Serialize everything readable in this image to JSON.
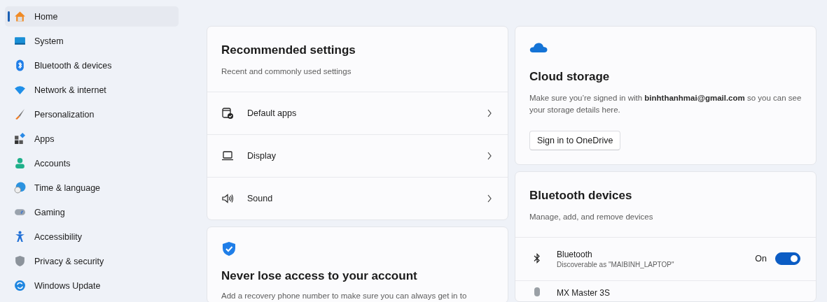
{
  "sidebar": {
    "items": [
      {
        "label": "Home",
        "selected": true
      },
      {
        "label": "System",
        "selected": false
      },
      {
        "label": "Bluetooth & devices",
        "selected": false
      },
      {
        "label": "Network & internet",
        "selected": false
      },
      {
        "label": "Personalization",
        "selected": false
      },
      {
        "label": "Apps",
        "selected": false
      },
      {
        "label": "Accounts",
        "selected": false
      },
      {
        "label": "Time & language",
        "selected": false
      },
      {
        "label": "Gaming",
        "selected": false
      },
      {
        "label": "Accessibility",
        "selected": false
      },
      {
        "label": "Privacy & security",
        "selected": false
      },
      {
        "label": "Windows Update",
        "selected": false
      }
    ]
  },
  "recommended": {
    "title": "Recommended settings",
    "subtitle": "Recent and commonly used settings",
    "items": [
      {
        "label": "Default apps"
      },
      {
        "label": "Display"
      },
      {
        "label": "Sound"
      }
    ]
  },
  "account_card": {
    "title": "Never lose access to your account",
    "text": "Add a recovery phone number to make sure you can always get in to"
  },
  "cloud_storage": {
    "title": "Cloud storage",
    "text": "Make sure you’re signed in with **binhthanhmai@gmail.com** so you can see your storage details here.",
    "button": "Sign in to OneDrive"
  },
  "bluetooth": {
    "title": "Bluetooth devices",
    "subtitle": "Manage, add, and remove devices",
    "devices": [
      {
        "kind": "toggle",
        "name": "Bluetooth",
        "detail": "Discoverable as \"MAIBINH_LAPTOP\"",
        "state_label": "On",
        "on": true
      },
      {
        "kind": "device",
        "name": "MX Master 3S"
      }
    ]
  }
}
